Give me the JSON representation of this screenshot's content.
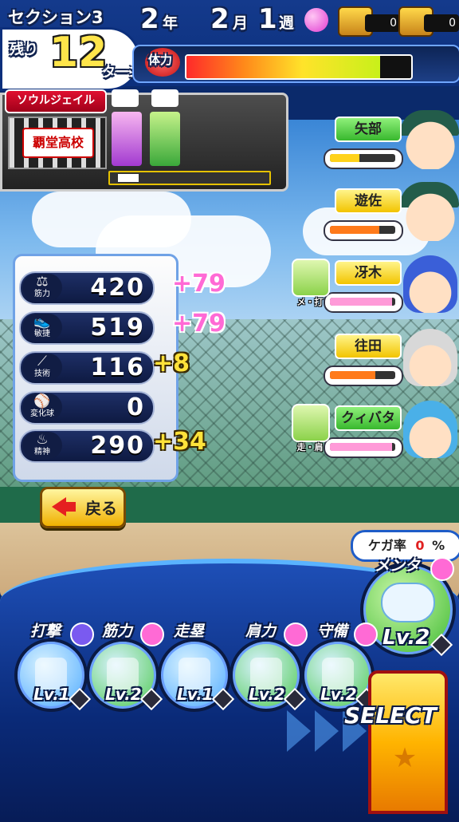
{
  "header": {
    "section": "セクション3",
    "remaining_label": "残り",
    "turns": "12",
    "turns_unit": "ターン",
    "year": "2",
    "year_unit": "年",
    "month": "2",
    "month_unit": "月",
    "week": "1",
    "week_unit": "週",
    "treasure_counts": [
      "0",
      "0"
    ]
  },
  "stamina": {
    "label": "体力",
    "fraction": 0.86
  },
  "school": {
    "label": "ソウルジェイル",
    "name": "覇堂高校"
  },
  "stats": [
    {
      "icon": "dumbbell-icon",
      "label": "筋力",
      "value": "420",
      "gain": "+79",
      "gain_color": "pink"
    },
    {
      "icon": "shoe-icon",
      "label": "敏捷",
      "value": "519",
      "gain": "+79",
      "gain_color": "pink"
    },
    {
      "icon": "bat-icon",
      "label": "技術",
      "value": "116",
      "gain": "+8",
      "gain_color": "yellow"
    },
    {
      "icon": "ball-icon",
      "label": "変化球",
      "value": "0",
      "gain": "",
      "gain_color": "none"
    },
    {
      "icon": "spirit-icon",
      "label": "精神",
      "value": "290",
      "gain": "+34",
      "gain_color": "yellow"
    }
  ],
  "back_button": {
    "label": "戻る"
  },
  "characters": [
    {
      "name": "矢部",
      "tag_color": "green",
      "bond": 0.45,
      "bond_color": "#ffd21a"
    },
    {
      "name": "遊佐",
      "tag_color": "yellow",
      "bond": 0.75,
      "bond_color": "#ff7a1a"
    },
    {
      "name": "冴木",
      "tag_color": "yellow",
      "bond": 0.95,
      "bond_color": "#ff9ad8",
      "event_label": "メ・打"
    },
    {
      "name": "往田",
      "tag_color": "yellow",
      "bond": 0.7,
      "bond_color": "#ff7a1a"
    },
    {
      "name": "クィバタ",
      "tag_color": "green",
      "bond": 0.95,
      "bond_color": "#ff9ad8",
      "event_label": "走・肩"
    }
  ],
  "injury": {
    "label": "ケガ率",
    "value": "0",
    "unit": "%"
  },
  "mental": {
    "title": "メンタ",
    "level": "Lv.2"
  },
  "training": [
    {
      "title": "打撃",
      "level": "Lv.1",
      "color": "#4aa8ff"
    },
    {
      "title": "筋力",
      "level": "Lv.2",
      "color": "#4ac84a"
    },
    {
      "title": "走塁",
      "level": "Lv.1",
      "color": "#4aa8ff"
    },
    {
      "title": "肩力",
      "level": "Lv.2",
      "color": "#4ac84a"
    },
    {
      "title": "守備",
      "level": "Lv.2",
      "color": "#4ac84a"
    }
  ],
  "select_button": {
    "label": "SELECT"
  },
  "colors": {
    "accent": "#1e5cc8",
    "gain_pink": "#ff6ad5",
    "gain_yellow": "#ffe23a"
  }
}
